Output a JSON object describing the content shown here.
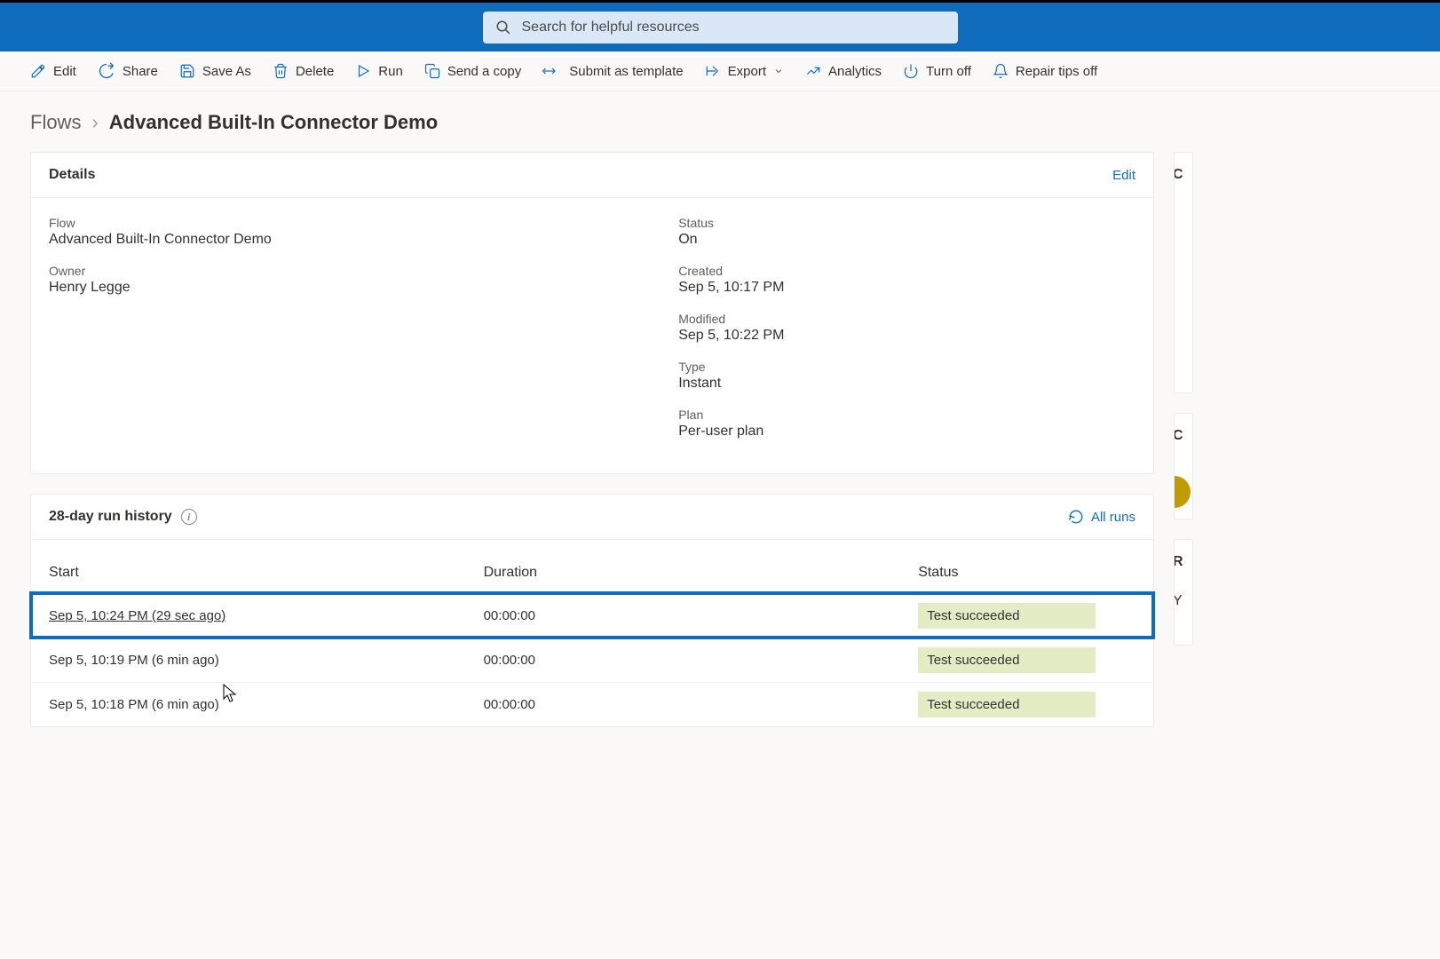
{
  "search": {
    "placeholder": "Search for helpful resources"
  },
  "toolbar": {
    "edit": "Edit",
    "share": "Share",
    "saveas": "Save As",
    "delete": "Delete",
    "run": "Run",
    "sendcopy": "Send a copy",
    "submit": "Submit as template",
    "export": "Export",
    "analytics": "Analytics",
    "turnoff": "Turn off",
    "repair": "Repair tips off"
  },
  "breadcrumb": {
    "root": "Flows",
    "current": "Advanced Built-In Connector Demo"
  },
  "details": {
    "title": "Details",
    "edit": "Edit",
    "flow_label": "Flow",
    "flow_value": "Advanced Built-In Connector Demo",
    "owner_label": "Owner",
    "owner_value": "Henry Legge",
    "status_label": "Status",
    "status_value": "On",
    "created_label": "Created",
    "created_value": "Sep 5, 10:17 PM",
    "modified_label": "Modified",
    "modified_value": "Sep 5, 10:22 PM",
    "type_label": "Type",
    "type_value": "Instant",
    "plan_label": "Plan",
    "plan_value": "Per-user plan"
  },
  "history": {
    "title": "28-day run history",
    "allruns": "All runs",
    "cols": {
      "start": "Start",
      "duration": "Duration",
      "status": "Status"
    },
    "rows": [
      {
        "start": "Sep 5, 10:24 PM (29 sec ago)",
        "duration": "00:00:00",
        "status": "Test succeeded",
        "highlighted": true
      },
      {
        "start": "Sep 5, 10:19 PM (6 min ago)",
        "duration": "00:00:00",
        "status": "Test succeeded",
        "highlighted": false
      },
      {
        "start": "Sep 5, 10:18 PM (6 min ago)",
        "duration": "00:00:00",
        "status": "Test succeeded",
        "highlighted": false
      }
    ]
  },
  "side": {
    "c_label": "C",
    "r_label": "R",
    "y_label": "Y"
  }
}
